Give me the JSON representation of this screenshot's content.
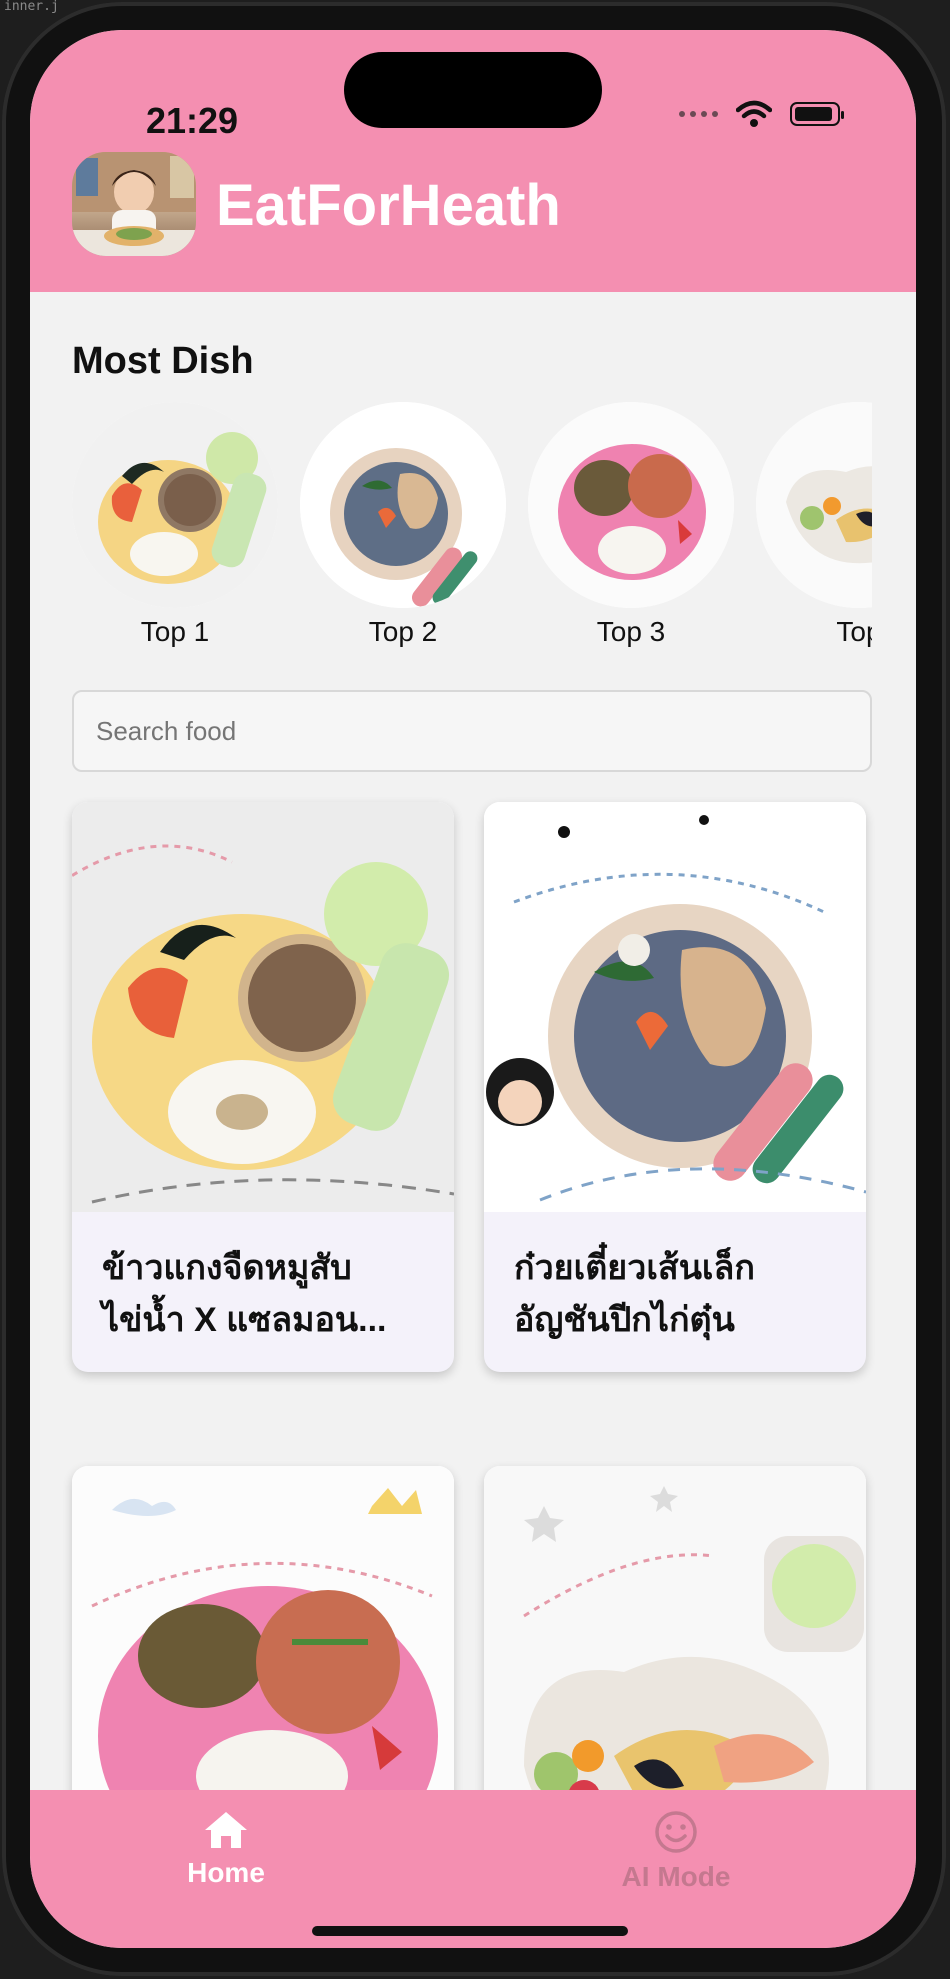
{
  "ide": {
    "filename_fragment": "inner.j"
  },
  "status_bar": {
    "time": "21:29"
  },
  "app": {
    "title": "EatForHeath",
    "brand_color": "#f48fb1"
  },
  "most_dish": {
    "title": "Most Dish",
    "items": [
      {
        "label": "Top 1"
      },
      {
        "label": "Top 2"
      },
      {
        "label": "Top 3"
      },
      {
        "label": "Top"
      }
    ]
  },
  "search": {
    "placeholder": "Search food"
  },
  "cards": [
    {
      "title_line1": "ข้าวแกงจืดหมูสับ",
      "title_line2": "ไข่น้ำ X แซลมอน..."
    },
    {
      "title_line1": "ก๋วยเตี๋ยวเส้นเล็ก",
      "title_line2": "อัญชันปีกไก่ตุ๋น"
    },
    {
      "title_line1": "",
      "title_line2": ""
    },
    {
      "title_line1": "",
      "title_line2": ""
    }
  ],
  "bottom_nav": {
    "items": [
      {
        "label": "Home",
        "icon": "home-icon",
        "active": true
      },
      {
        "label": "AI Mode",
        "icon": "smiley-icon",
        "active": false
      }
    ]
  }
}
